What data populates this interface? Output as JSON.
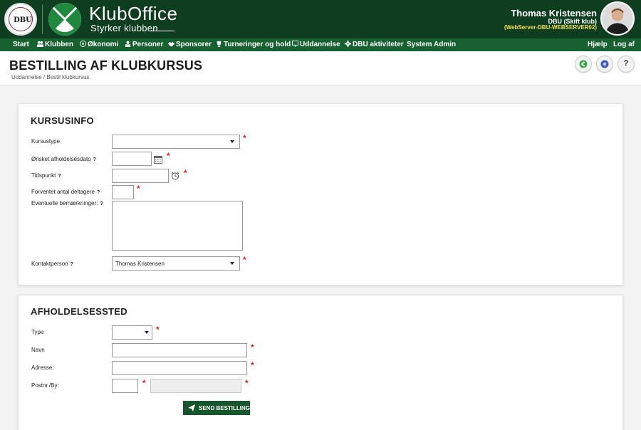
{
  "header": {
    "dbu_logo_text": "DBU",
    "brand_title": "KlubOffice",
    "brand_subtitle": "Styrker klubben",
    "user_name": "Thomas Kristensen",
    "user_club": "DBU (Skift klub)",
    "user_server": "(WebServer-DBU-WEBSERVER02)"
  },
  "nav": {
    "items": [
      {
        "label": "Start",
        "icon": ""
      },
      {
        "label": "Klubben",
        "icon": "people-icon"
      },
      {
        "label": "Økonomi",
        "icon": "coin-icon"
      },
      {
        "label": "Personer",
        "icon": "person-icon"
      },
      {
        "label": "Sponsorer",
        "icon": "handshake-icon"
      },
      {
        "label": "Turneringer og hold",
        "icon": "trophy-icon"
      },
      {
        "label": "Uddannelse",
        "icon": "board-icon"
      },
      {
        "label": "DBU aktiviteter",
        "icon": "gear-icon"
      },
      {
        "label": "System Admin",
        "icon": ""
      }
    ],
    "help_label": "Hjælp",
    "logout_label": "Log af"
  },
  "page": {
    "title": "BESTILLING AF KLUBKURSUS",
    "breadcrumb": "Uddannelse / Bestil klubkursus",
    "help_button": "?"
  },
  "kursusinfo": {
    "title": "KURSUSINFO",
    "kursustype_label": "Kursustype",
    "kursustype_value": "",
    "dato_label": "Ønsket afholdelsesdato",
    "dato_value": "",
    "tidspunkt_label": "Tidspunkt",
    "tidspunkt_value": "",
    "deltagere_label": "Forventet antal deltagere",
    "deltagere_value": "",
    "bemaerkninger_label": "Eventuelle bemærkninger:",
    "bemaerkninger_value": "",
    "kontakt_label": "Kontaktperson",
    "kontakt_value": "Thomas Kristensen",
    "help_mark": "?",
    "required_mark": "*"
  },
  "afholdelsessted": {
    "title": "AFHOLDELSESSTED",
    "type_label": "Type",
    "type_value": "",
    "navn_label": "Navn",
    "navn_value": "",
    "adresse_label": "Adresse:",
    "adresse_value": "",
    "postnr_label": "Postnr./By:",
    "postnr_value": "",
    "by_value": "",
    "send_label": "SEND BESTILLING"
  },
  "colors": {
    "header_bg": "#0f3d20",
    "nav_bg": "#17602f",
    "accent_green": "#17562c",
    "required": "#e02020",
    "server_text": "#f2e24a"
  }
}
